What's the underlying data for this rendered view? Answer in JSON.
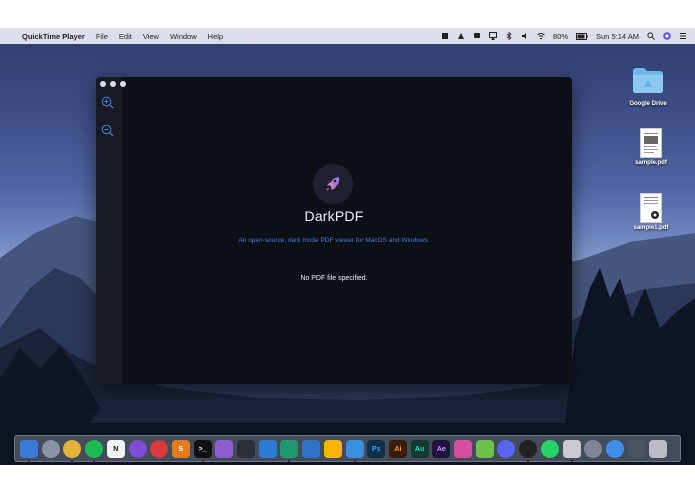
{
  "menubar": {
    "apple_label": "",
    "app_name": "QuickTime Player",
    "items": [
      "File",
      "Edit",
      "View",
      "Window",
      "Help"
    ],
    "battery": "80%",
    "clock": "Sun 5:14 AM"
  },
  "app_window": {
    "title": "DarkPDF",
    "tagline": "An open-source, dark mode PDF viewer for MacOS and Windows.",
    "status": "No PDF file specified.",
    "accent_color": "#3d7fd6",
    "background_color": "#0d0f16"
  },
  "desktop_icons": [
    {
      "label": "Google Drive",
      "icon": "folder-icon"
    },
    {
      "label": "sample.pdf",
      "icon": "pdf-file-icon"
    },
    {
      "label": "sample1.pdf",
      "icon": "pdf-file-icon"
    }
  ],
  "dock": {
    "apps": [
      {
        "name": "finder-app",
        "glyph": "",
        "color": "#3b7bd8"
      },
      {
        "name": "launchpad-app",
        "glyph": "",
        "color": "#8a93a6"
      },
      {
        "name": "chrome-app",
        "glyph": "",
        "color": "#e2b53a"
      },
      {
        "name": "spotify-app",
        "glyph": "",
        "color": "#1db954"
      },
      {
        "name": "notion-app",
        "glyph": "N",
        "color": "#f3f3f3"
      },
      {
        "name": "purple-app",
        "glyph": "",
        "color": "#7e4ad6"
      },
      {
        "name": "red-app",
        "glyph": "",
        "color": "#d93b3b"
      },
      {
        "name": "sublime-app",
        "glyph": "S",
        "color": "#e07b1e"
      },
      {
        "name": "terminal-app",
        "glyph": ">_",
        "color": "#111111"
      },
      {
        "name": "github-app",
        "glyph": "",
        "color": "#8e5bd0"
      },
      {
        "name": "dark-app",
        "glyph": "",
        "color": "#2a2f3a"
      },
      {
        "name": "vscode-app",
        "glyph": "",
        "color": "#2b7ad3"
      },
      {
        "name": "pycharm-app",
        "glyph": "",
        "color": "#1f9a6e"
      },
      {
        "name": "sourcetree-app",
        "glyph": "",
        "color": "#2f74c9"
      },
      {
        "name": "sketch-app",
        "glyph": "",
        "color": "#f4b400"
      },
      {
        "name": "xcode-app",
        "glyph": "",
        "color": "#3b8fe0"
      },
      {
        "name": "photoshop-app",
        "glyph": "Ps",
        "color": "#0d2f4a"
      },
      {
        "name": "illustrator-app",
        "glyph": "Ai",
        "color": "#3a1d08"
      },
      {
        "name": "audition-app",
        "glyph": "Au",
        "color": "#0f3b33"
      },
      {
        "name": "aftereffects-app",
        "glyph": "Ae",
        "color": "#211340"
      },
      {
        "name": "colorful-app",
        "glyph": "",
        "color": "#d64fa0"
      },
      {
        "name": "android-app",
        "glyph": "",
        "color": "#6cc24a"
      },
      {
        "name": "discord-app",
        "glyph": "",
        "color": "#5865f2"
      },
      {
        "name": "obs-app",
        "glyph": "",
        "color": "#222222"
      },
      {
        "name": "whatsapp-app",
        "glyph": "",
        "color": "#25d366"
      },
      {
        "name": "preview-app",
        "glyph": "",
        "color": "#c9cbd2"
      },
      {
        "name": "system-preferences-app",
        "glyph": "",
        "color": "#7d8696"
      },
      {
        "name": "safari-app",
        "glyph": "",
        "color": "#3f8fe8"
      },
      {
        "name": "downloads-stack",
        "glyph": "",
        "color": "#4b5262"
      },
      {
        "name": "trash",
        "glyph": "",
        "color": "#b7bcc6"
      }
    ]
  }
}
